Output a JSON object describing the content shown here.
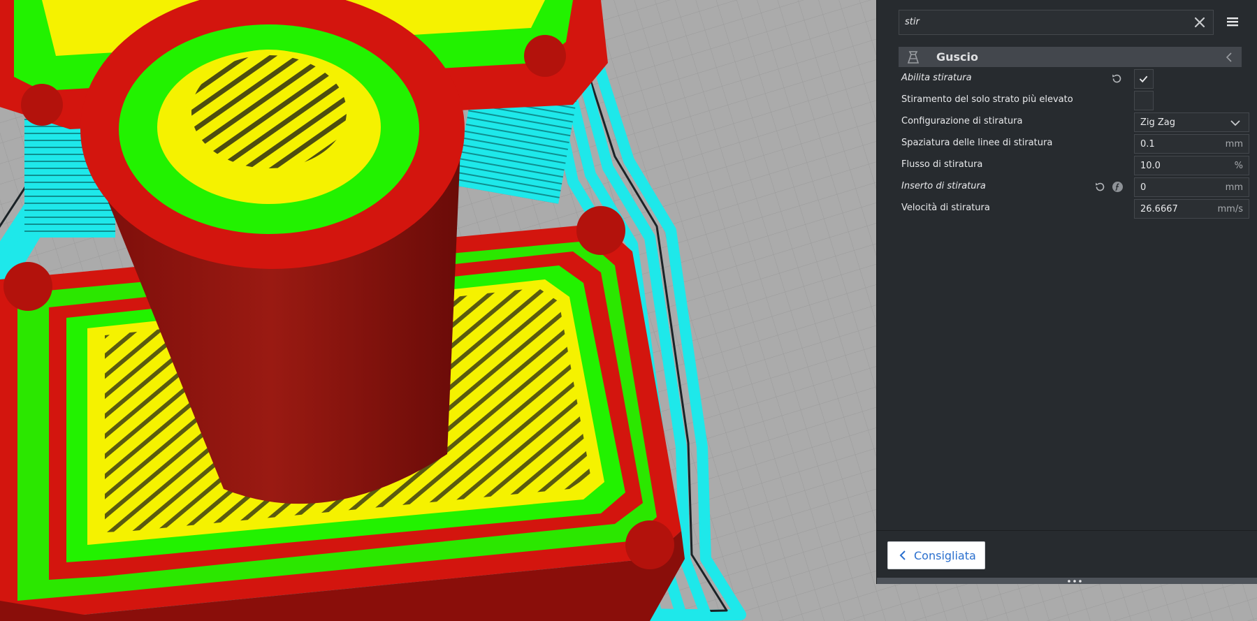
{
  "search": {
    "value": "stir"
  },
  "category": {
    "icon": "shell-icon",
    "label": "Guscio"
  },
  "settings": [
    {
      "label": "Abilita stiratura",
      "italic": true,
      "control": "checkbox",
      "checked": true,
      "reset": true
    },
    {
      "label": "Stiramento del solo strato più elevato",
      "italic": false,
      "control": "checkbox",
      "checked": false
    },
    {
      "label": "Configurazione di stiratura",
      "italic": false,
      "control": "dropdown",
      "value": "Zig Zag"
    },
    {
      "label": "Spaziatura delle linee di stiratura",
      "italic": false,
      "control": "number",
      "value": "0.1",
      "unit": "mm"
    },
    {
      "label": "Flusso di stiratura",
      "italic": false,
      "control": "number",
      "value": "10.0",
      "unit": "%"
    },
    {
      "label": "Inserto di stiratura",
      "italic": true,
      "control": "number",
      "value": "0",
      "unit": "mm",
      "reset": true,
      "info": true
    },
    {
      "label": "Velocità di stiratura",
      "italic": false,
      "control": "number",
      "value": "26.6667",
      "unit": "mm/s"
    }
  ],
  "footer": {
    "recommended_label": "Consigliata"
  },
  "colors": {
    "panel": "#272b2f",
    "category_bar": "#43474d",
    "accent_blue": "#2a6fce",
    "preview_red": "#d3150e",
    "preview_green": "#22f200",
    "preview_yellow": "#f5f200",
    "preview_cyan": "#1ee8ea",
    "build_plate": "#a9a9a9"
  }
}
